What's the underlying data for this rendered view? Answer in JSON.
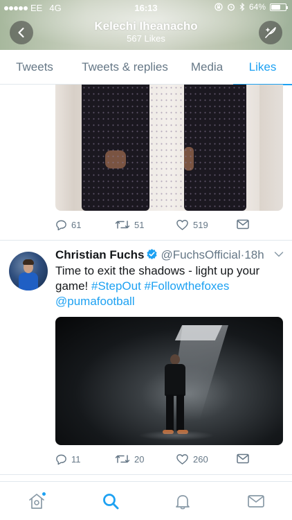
{
  "status_bar": {
    "carrier": "EE",
    "network": "4G",
    "time": "16:13",
    "battery": "64%",
    "battery_level": 0.64,
    "icons": [
      "signal-dots-icon",
      "rotation-lock-icon",
      "alarm-icon",
      "bluetooth-icon",
      "battery-icon"
    ]
  },
  "header": {
    "title": "Kelechi Iheanacho",
    "subtitle": "567 Likes",
    "back_icon": "chevron-left-icon",
    "compose_icon": "compose-feather-icon"
  },
  "tabs": [
    {
      "label": "Tweets",
      "active": false
    },
    {
      "label": "Tweets & replies",
      "active": false
    },
    {
      "label": "Media",
      "active": false
    },
    {
      "label": "Likes",
      "active": true
    }
  ],
  "tweets": [
    {
      "actions": {
        "replies": "61",
        "retweets": "51",
        "likes": "519"
      }
    },
    {
      "name": "Christian Fuchs",
      "verified": true,
      "handle": "@FuchsOfficial",
      "separator": "·",
      "time": "18h",
      "text_plain": "Time to exit the shadows - light up your game! ",
      "hashtag1": "#StepOut",
      "hashtag2": "#Followthefoxes",
      "mention": "@pumafootball",
      "actions": {
        "replies": "11",
        "retweets": "20",
        "likes": "260"
      }
    }
  ],
  "bottom_nav": [
    {
      "name": "home-icon",
      "active": false,
      "badge": true
    },
    {
      "name": "search-icon",
      "active": true
    },
    {
      "name": "notifications-bell-icon",
      "active": false
    },
    {
      "name": "messages-envelope-icon",
      "active": false
    }
  ],
  "colors": {
    "accent": "#1da1f2",
    "text": "#14171a",
    "secondary": "#657786",
    "border": "#e1e8ed"
  }
}
